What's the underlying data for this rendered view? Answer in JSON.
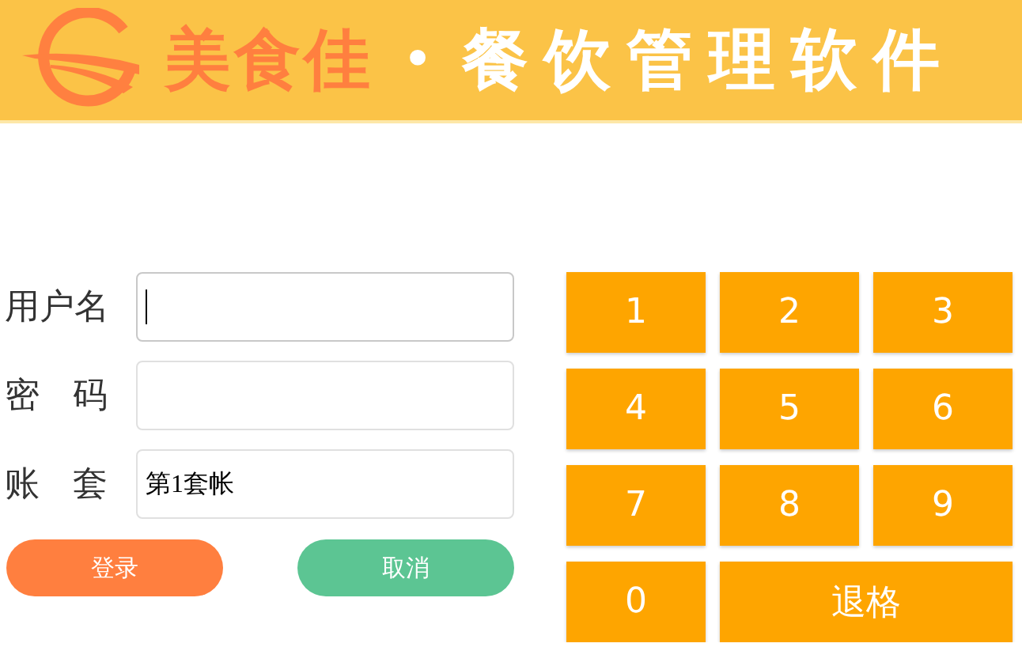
{
  "header": {
    "brand": "美食佳",
    "separator": "•",
    "tagline": "餐饮管理软件"
  },
  "form": {
    "fields": [
      {
        "label": "用户名",
        "focused": true
      },
      {
        "label": "密 码",
        "focused": false
      },
      {
        "label": "账 套",
        "value": "第1套帐",
        "focused": false
      }
    ],
    "buttons": [
      {
        "label": "登录",
        "kind": "primary"
      },
      {
        "label": "取消",
        "kind": "secondary"
      }
    ]
  },
  "keypad": [
    {
      "label": "1",
      "kind": "digit"
    },
    {
      "label": "2",
      "kind": "digit"
    },
    {
      "label": "3",
      "kind": "digit"
    },
    {
      "label": "4",
      "kind": "digit"
    },
    {
      "label": "5",
      "kind": "digit"
    },
    {
      "label": "6",
      "kind": "digit"
    },
    {
      "label": "7",
      "kind": "digit"
    },
    {
      "label": "8",
      "kind": "digit"
    },
    {
      "label": "9",
      "kind": "digit"
    },
    {
      "label": "0",
      "kind": "digit"
    },
    {
      "label": "退格",
      "kind": "backspace"
    }
  ]
}
